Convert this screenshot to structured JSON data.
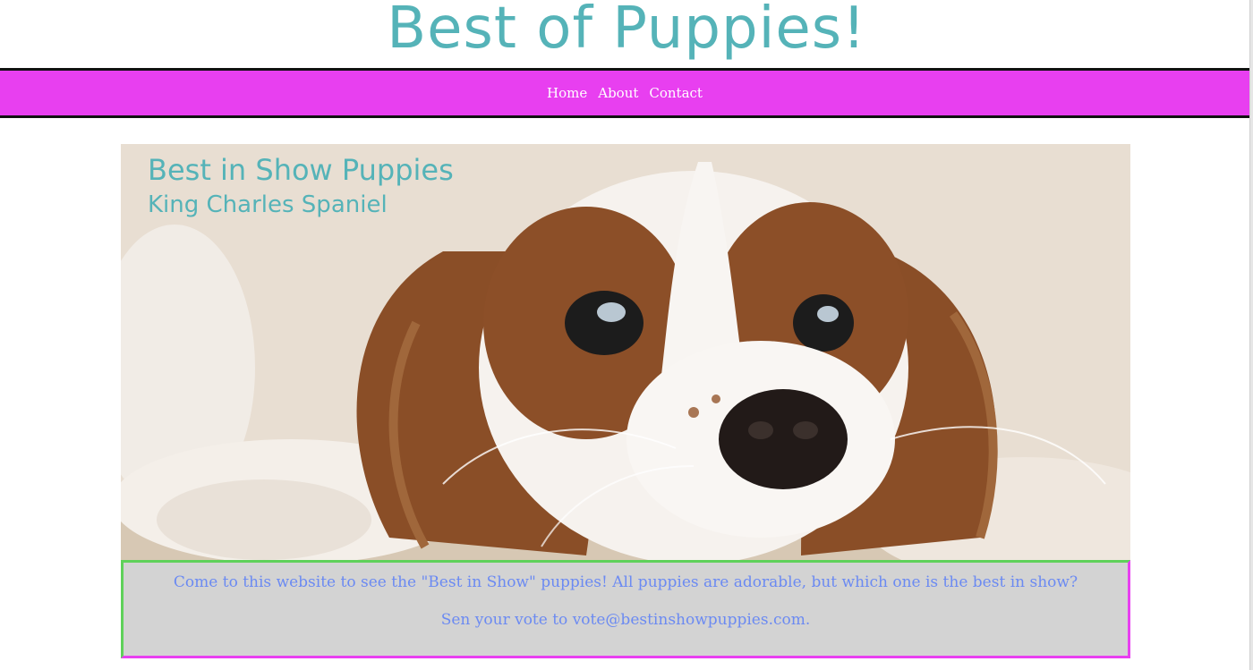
{
  "header": {
    "site_title": "Best of Puppies!"
  },
  "nav": {
    "items": [
      "Home",
      "About",
      "Contact"
    ]
  },
  "hero": {
    "heading": "Best in Show Puppies",
    "subheading": "King Charles Spaniel",
    "image_subject": "cavalier-king-charles-spaniel-puppy-photo"
  },
  "info": {
    "line1": "Come to this website to see the \"Best in Show\" puppies! All puppies are adorable, but which one is the best in show?",
    "line2": "Sen your vote to vote@bestinshowpuppies.com."
  },
  "colors": {
    "title_teal": "#55b3b8",
    "nav_magenta": "#e83ff0",
    "info_text_blue": "#6b8af2",
    "info_bg_gray": "#d3d3d3",
    "border_green": "#5fd15a"
  }
}
